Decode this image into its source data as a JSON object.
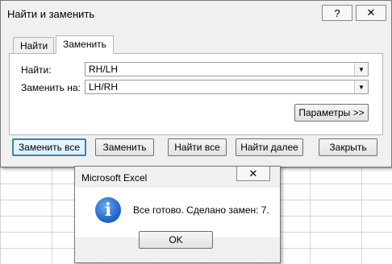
{
  "find_replace": {
    "title": "Найти и заменить",
    "help_glyph": "?",
    "close_glyph": "✕",
    "tabs": [
      {
        "label": "Найти",
        "active": false
      },
      {
        "label": "Заменить",
        "active": true
      }
    ],
    "find_label": "Найти:",
    "find_value": "RH/LH",
    "replace_label": "Заменить на:",
    "replace_value": "LH/RH",
    "options_button": "Параметры >>",
    "buttons": {
      "replace_all": "Заменить все",
      "replace": "Заменить",
      "find_all": "Найти все",
      "find_next": "Найти далее",
      "close": "Закрыть"
    }
  },
  "message_box": {
    "title": "Microsoft Excel",
    "close_glyph": "✕",
    "icon": "information-icon",
    "icon_glyph": "i",
    "text": "Все готово. Сделано замен: 7.",
    "ok_button": "OK"
  }
}
